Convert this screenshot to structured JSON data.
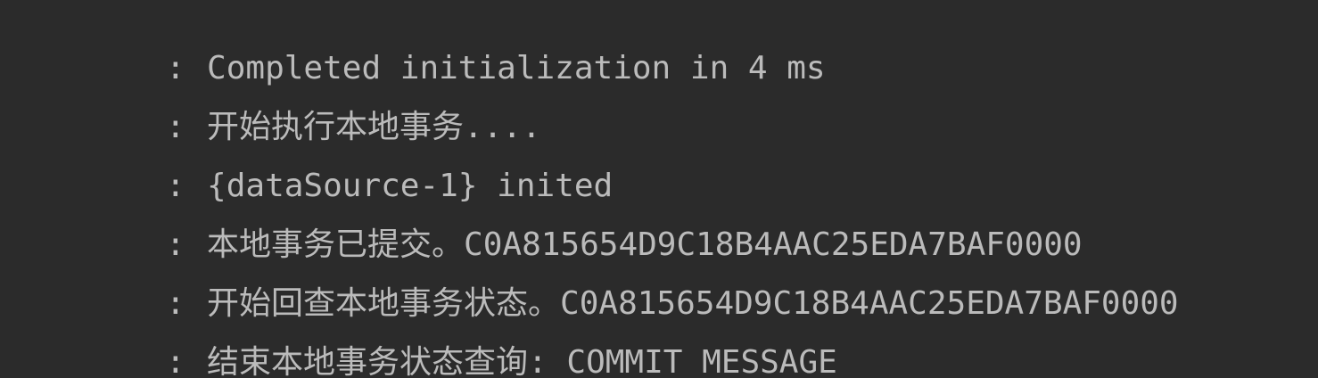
{
  "console": {
    "lines": [
      {
        "prefix": ":",
        "message": "Completed initialization in 4 ms"
      },
      {
        "prefix": ":",
        "message": "开始执行本地事务...."
      },
      {
        "prefix": ":",
        "message": "{dataSource-1} inited"
      },
      {
        "prefix": ":",
        "message": "本地事务已提交。C0A815654D9C18B4AAC25EDA7BAF0000"
      },
      {
        "prefix": ":",
        "message": "开始回查本地事务状态。C0A815654D9C18B4AAC25EDA7BAF0000"
      },
      {
        "prefix": ":",
        "message": "结束本地事务状态查询: COMMIT_MESSAGE"
      }
    ]
  },
  "colors": {
    "background": "#2b2b2b",
    "text": "#bbbbbb"
  }
}
